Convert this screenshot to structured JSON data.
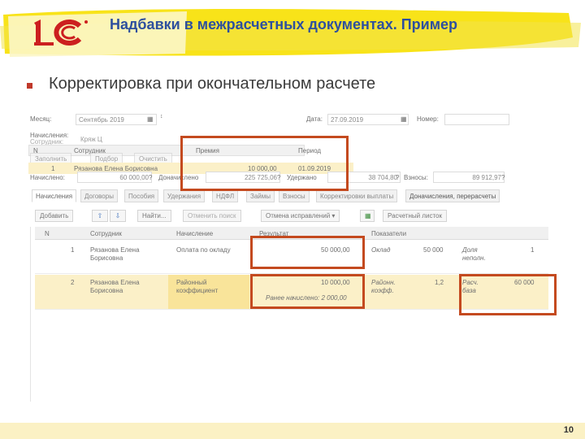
{
  "slide": {
    "title": "Надбавки в межрасчетных документах. Пример",
    "bullet": "Корректировка при окончательном расчете",
    "page_number": "10",
    "colors": {
      "title": "#2d4f9e",
      "highlight_frame": "#c44a1f",
      "marker": "#f7e000",
      "logo_red": "#cc1f1f"
    },
    "logo": "1c-logo"
  },
  "doc": {
    "month_label": "Месяц:",
    "month_value": "Сентябрь 2019",
    "date_label": "Дата:",
    "date_value": "27.09.2019",
    "number_label": "Номер:",
    "accruals_label": "Начисления:",
    "employee_label": "Сотрудник:",
    "employee_value": "Кряж Ц",
    "fill_button": "Заполнить",
    "select_button": "Подбор",
    "clear_button": "Очистить",
    "inner_table": {
      "headers": [
        "N",
        "Сотрудник",
        "Премия",
        "Период"
      ],
      "row": {
        "n": "1",
        "employee": "Рязанова Елена Борисовна",
        "bonus": "10 000,00",
        "period": "01.09.2019"
      }
    },
    "totals": {
      "accrued_label": "Начислено:",
      "accrued_value": "60 000,00",
      "income_label": "Доначислено",
      "income_value": "225 725,06",
      "withheld_label": "Удержано",
      "withheld_value": "38 704,80",
      "contrib_label": "Взносы:",
      "contrib_value": "89 912,97",
      "q": "?"
    },
    "tabs": [
      "Начисления",
      "Договоры",
      "Пособия",
      "Удержания",
      "НДФЛ",
      "Займы",
      "Взносы",
      "Корректировки выплаты",
      "Доначисления, перерасчеты"
    ],
    "toolbar": {
      "add": "Добавить",
      "find": "Найти...",
      "cancel_search": "Отменить поиск",
      "cancel_fixes": "Отмена исправлений",
      "payslip": "Расчетный листок",
      "up_icon": "arrow-up-icon",
      "down_icon": "arrow-down-icon",
      "sheet_icon": "table-icon"
    },
    "main_table": {
      "headers": [
        "N",
        "Сотрудник",
        "Начисление",
        "Результат",
        "Показатели"
      ],
      "rows": [
        {
          "n": "1",
          "employee": [
            "Рязанова Елена",
            "Борисовна"
          ],
          "accrual": "Оплата по окладу",
          "result": "50 000,00",
          "earlier": "",
          "ind_name": "Оклад",
          "ind_value": "50 000",
          "ind2_name": [
            "Доля",
            "неполн."
          ],
          "ind2_value": "1"
        },
        {
          "n": "2",
          "employee": [
            "Рязанова Елена",
            "Борисовна"
          ],
          "accrual": [
            "Районный",
            "коэффициент"
          ],
          "result": "10 000,00",
          "earlier": "Ранее начислено: 2 000,00",
          "ind_name": [
            "Районн.",
            "коэфф."
          ],
          "ind_value": "1,2",
          "ind2_name": [
            "Расч.",
            "база"
          ],
          "ind2_value": "60 000"
        }
      ]
    }
  }
}
